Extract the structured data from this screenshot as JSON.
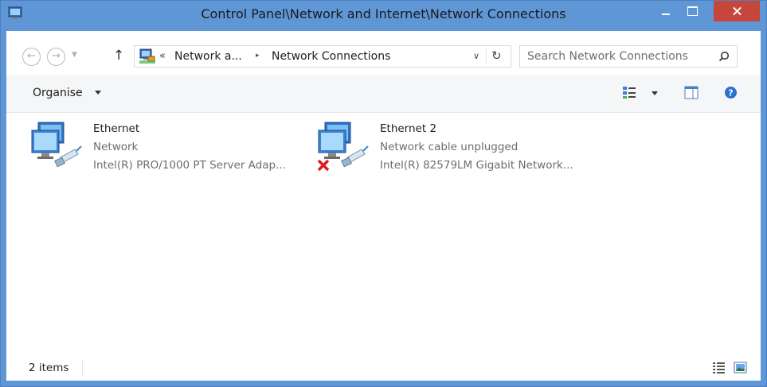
{
  "window": {
    "title": "Control Panel\\Network and Internet\\Network Connections",
    "accent": "#5f97d6",
    "close_color": "#c7463b"
  },
  "titlebar": {
    "icon": "network-connections-icon",
    "minimize_icon": "minimize-icon",
    "maximize_icon": "maximize-icon",
    "close_icon": "close-icon"
  },
  "nav": {
    "back_icon": "back-arrow-icon",
    "forward_icon": "forward-arrow-icon",
    "recent_icon": "chevron-down-icon",
    "up_icon": "up-arrow-icon"
  },
  "address": {
    "overflow": "«",
    "crumbs": [
      "Network a...",
      "Network Connections"
    ],
    "separator": "▸",
    "dropdown_glyph": "∨",
    "refresh_glyph": "↻"
  },
  "search": {
    "placeholder": "Search Network Connections"
  },
  "commandbar": {
    "organise_label": "Organise",
    "view_icon": "change-view-icon",
    "preview_icon": "preview-pane-icon",
    "help_icon": "help-icon"
  },
  "items": [
    {
      "name": "Ethernet",
      "status": "Network",
      "device": "Intel(R) PRO/1000 PT Server Adap...",
      "icon": "ethernet-adapter-icon",
      "disconnected": false
    },
    {
      "name": "Ethernet 2",
      "status": "Network cable unplugged",
      "device": "Intel(R) 82579LM Gigabit Network...",
      "icon": "ethernet-adapter-icon",
      "disconnected": true
    }
  ],
  "statusbar": {
    "count": "2 items",
    "details_icon": "details-view-icon",
    "large_icons_icon": "large-icons-view-icon"
  }
}
